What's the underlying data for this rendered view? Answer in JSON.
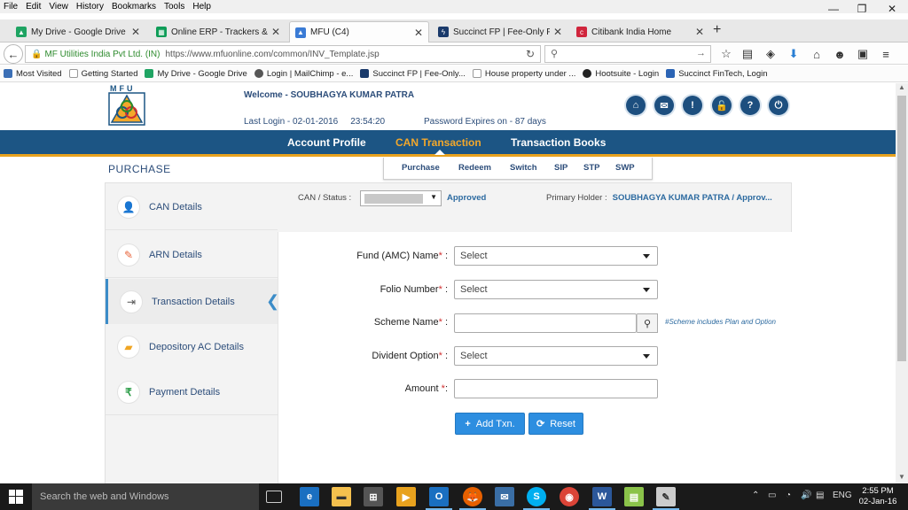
{
  "menu": {
    "items": [
      "File",
      "Edit",
      "View",
      "History",
      "Bookmarks",
      "Tools",
      "Help"
    ]
  },
  "window_controls": {
    "minimize": "—",
    "maximize": "❐",
    "close": "✕"
  },
  "tabs": [
    {
      "label": "My Drive - Google Drive",
      "icon": "google-drive-icon",
      "color": "#1fa463"
    },
    {
      "label": "Online ERP - Trackers & O...",
      "icon": "sheets-icon",
      "color": "#0f9d58"
    },
    {
      "label": "MFU (C4)",
      "icon": "mfu-icon",
      "color": "#3a7bd5",
      "active": true
    },
    {
      "label": "Succinct FP | Fee-Only Fin...",
      "icon": "lightning-icon",
      "color": "#1a3a6b"
    },
    {
      "label": "Citibank India Home",
      "icon": "citi-icon",
      "color": "#d0253c"
    }
  ],
  "newtab": "+",
  "address": {
    "org": "MF Utilities India Pvt Ltd. (IN)",
    "url": "https://www.mfuonline.com/common/INV_Template.jsp",
    "reload": "↻"
  },
  "search": {
    "placeholder": ""
  },
  "bookmarks": [
    {
      "label": "Most Visited",
      "color": "#3b6fb6"
    },
    {
      "label": "Getting Started",
      "color": "#ffffff"
    },
    {
      "label": "My Drive - Google Drive",
      "color": "#1fa463"
    },
    {
      "label": "Login | MailChimp - e...",
      "color": "#555555"
    },
    {
      "label": "Succinct FP | Fee-Only...",
      "color": "#1a3a6b"
    },
    {
      "label": "House property under ...",
      "color": "#ffffff"
    },
    {
      "label": "Hootsuite - Login",
      "color": "#222222"
    },
    {
      "label": "Succinct FinTech, Login",
      "color": "#2a63b4"
    }
  ],
  "site": {
    "logo_text": "MFU",
    "welcome": "Welcome - SOUBHAGYA KUMAR PATRA",
    "last_login_label": "Last Login - 02-01-2016",
    "last_login_time": "23:54:20",
    "password_expiry": "Password Expires on - 87 days",
    "header_icons": [
      "home-icon",
      "mail-icon",
      "info-icon",
      "lock-icon",
      "help-icon",
      "power-icon"
    ],
    "accent": "#e8a21e",
    "nav_bg": "#1c5584"
  },
  "mainnav": [
    {
      "label": "Account Profile",
      "active": false
    },
    {
      "label": "CAN Transaction",
      "active": true
    },
    {
      "label": "Transaction Books",
      "active": false
    }
  ],
  "subnav": [
    "Purchase",
    "Redeem",
    "Switch",
    "SIP",
    "STP",
    "SWP"
  ],
  "page_title": "PURCHASE",
  "can": {
    "label": "CAN / Status :",
    "status": "Approved",
    "primary_label": "Primary Holder :",
    "primary_value": "SOUBHAGYA KUMAR PATRA / Approv..."
  },
  "sidebar": [
    {
      "label": "CAN Details",
      "icon": "user-icon",
      "color": "#3b8cc8"
    },
    {
      "label": "ARN Details",
      "icon": "edit-icon",
      "color": "#e8643a"
    },
    {
      "label": "Transaction Details",
      "icon": "sign-in-icon",
      "color": "#555555",
      "active": true
    },
    {
      "label": "Depository AC Details",
      "icon": "briefcase-icon",
      "color": "#f0a523"
    },
    {
      "label": "Payment Details",
      "icon": "rupee-icon",
      "color": "#2e9e4a"
    }
  ],
  "form": {
    "fund_label": "Fund (AMC) Name",
    "fund_value": "Select",
    "folio_label": "Folio Number",
    "folio_value": "Select",
    "scheme_label": "Scheme Name",
    "scheme_value": "",
    "scheme_note": "#Scheme includes Plan and Option",
    "dividend_label": "Divident Option",
    "dividend_value": "Select",
    "amount_label": "Amount",
    "amount_value": "",
    "req": "*",
    "colon": ":",
    "add_button": "Add Txn.",
    "reset_button": "Reset"
  },
  "taskbar": {
    "search_placeholder": "Search the web and Windows",
    "apps": [
      "task-view-icon",
      "edge-icon",
      "file-explorer-icon",
      "store-icon",
      "media-icon",
      "outlook-icon",
      "firefox-icon",
      "mail-icon",
      "skype-icon",
      "chrome-icon",
      "word-icon",
      "notepad-icon",
      "paint-icon"
    ],
    "lang": "ENG",
    "time": "2:55 PM",
    "date": "02-Jan-16"
  }
}
